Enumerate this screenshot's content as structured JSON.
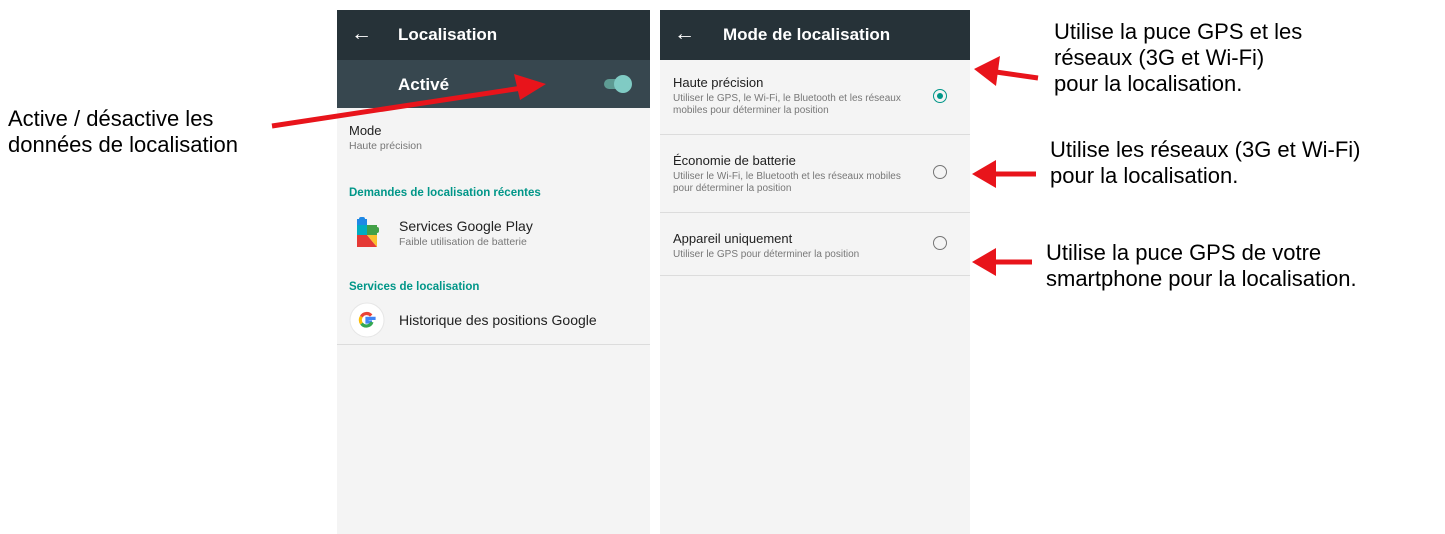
{
  "annotations": {
    "left_line1": "Active / désactive les",
    "left_line2": "données de localisation",
    "right1_line1": "Utilise la puce GPS et les",
    "right1_line2": "réseaux (3G et Wi-Fi)",
    "right1_line3": "pour la localisation.",
    "right2_line1": "Utilise les réseaux (3G et Wi-Fi)",
    "right2_line2": "pour la localisation.",
    "right3_line1": "Utilise la puce GPS de votre",
    "right3_line2": "smartphone pour la localisation.",
    "arrow_color": "#e8141b"
  },
  "left_screen": {
    "back_icon": "←",
    "title": "Localisation",
    "switch_label": "Activé",
    "switch_on": true,
    "mode_title": "Mode",
    "mode_value": "Haute précision",
    "section_recent": "Demandes de localisation récentes",
    "recent_app_name": "Services Google Play",
    "recent_app_sub": "Faible utilisation de batterie",
    "section_services": "Services de localisation",
    "service_name": "Historique des positions Google"
  },
  "right_screen": {
    "back_icon": "←",
    "title": "Mode de localisation",
    "options": [
      {
        "title": "Haute précision",
        "sub": "Utiliser le GPS, le Wi-Fi, le Bluetooth et les réseaux mobiles pour déterminer la position",
        "selected": true
      },
      {
        "title": "Économie de batterie",
        "sub": "Utiliser le Wi-Fi, le Bluetooth et les réseaux mobiles pour déterminer la position",
        "selected": false
      },
      {
        "title": "Appareil uniquement",
        "sub": "Utiliser le GPS pour déterminer la position",
        "selected": false
      }
    ]
  },
  "colors": {
    "appbar": "#263238",
    "switchbar": "#37474f",
    "accent": "#009688",
    "toggle": "#80cbc4"
  }
}
